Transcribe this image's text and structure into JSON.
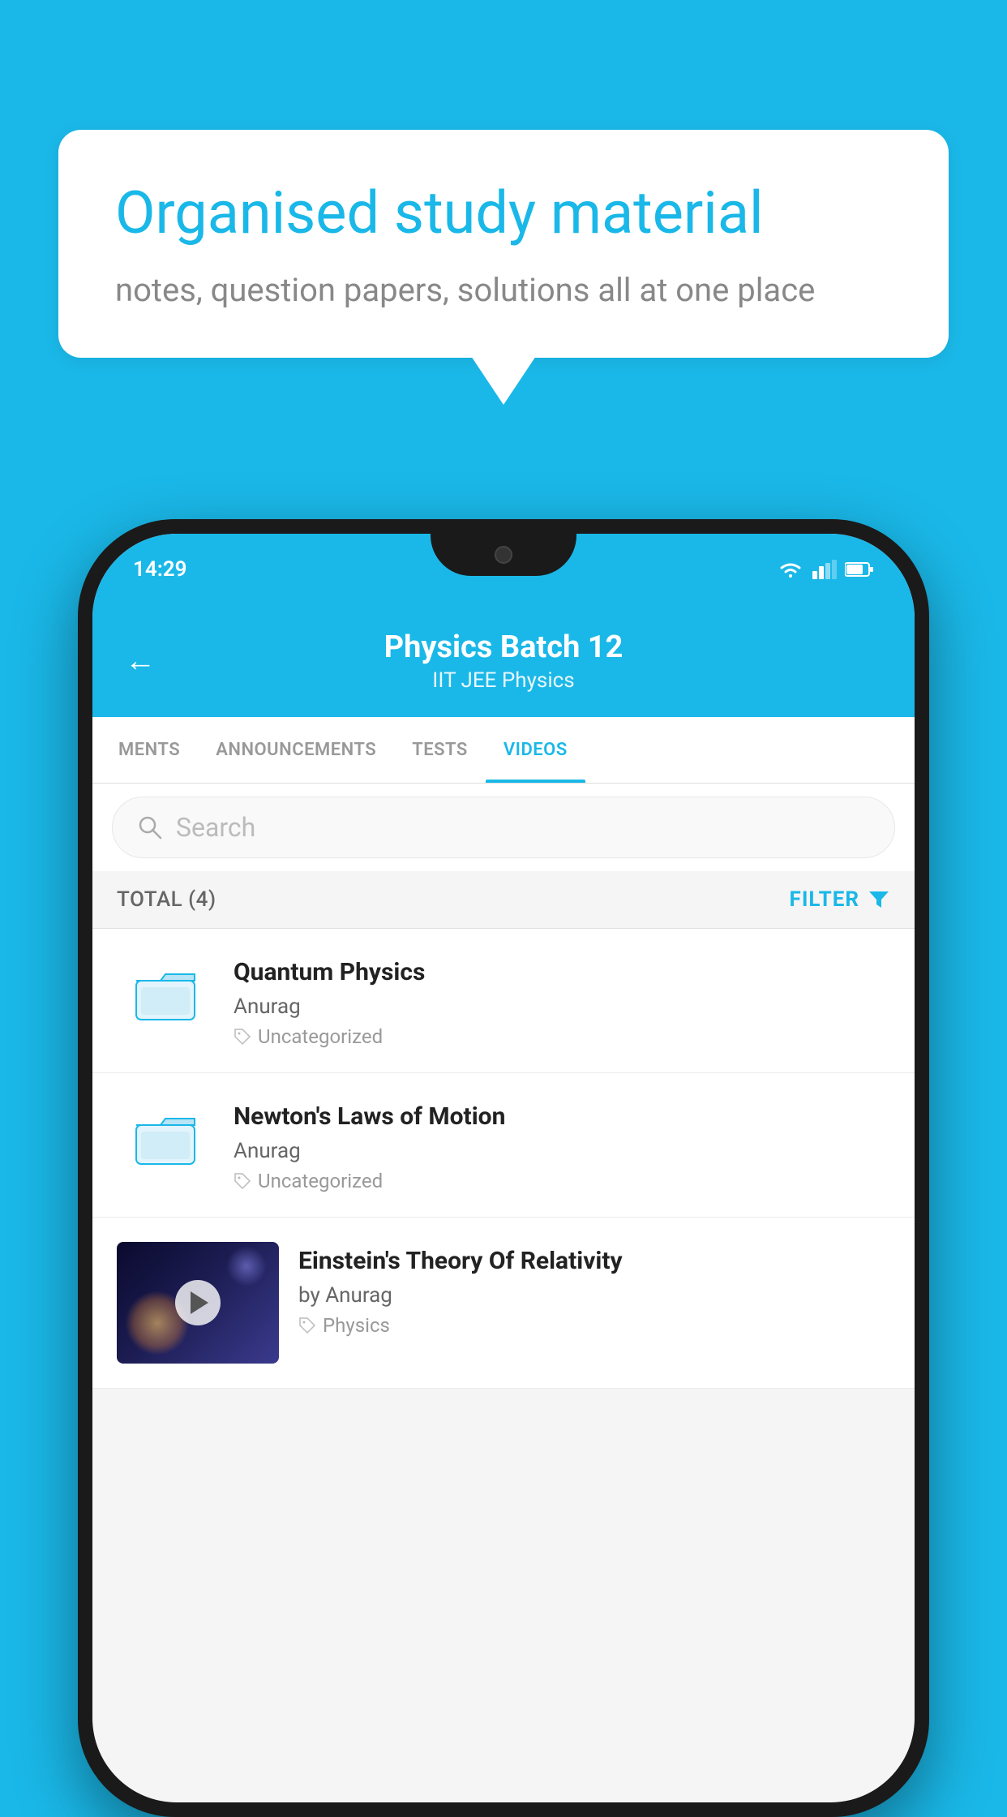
{
  "background": {
    "color": "#1ab8e8"
  },
  "speech_bubble": {
    "title": "Organised study material",
    "subtitle": "notes, question papers, solutions all at one place"
  },
  "phone": {
    "status_bar": {
      "time": "14:29"
    },
    "header": {
      "title": "Physics Batch 12",
      "subtitle": "IIT JEE   Physics",
      "back_label": "←"
    },
    "tabs": [
      {
        "label": "MENTS",
        "active": false
      },
      {
        "label": "ANNOUNCEMENTS",
        "active": false
      },
      {
        "label": "TESTS",
        "active": false
      },
      {
        "label": "VIDEOS",
        "active": true
      }
    ],
    "search": {
      "placeholder": "Search"
    },
    "filter_bar": {
      "total_label": "TOTAL (4)",
      "filter_label": "FILTER"
    },
    "videos": [
      {
        "id": 1,
        "title": "Quantum Physics",
        "author": "Anurag",
        "tag": "Uncategorized",
        "type": "folder"
      },
      {
        "id": 2,
        "title": "Newton's Laws of Motion",
        "author": "Anurag",
        "tag": "Uncategorized",
        "type": "folder"
      },
      {
        "id": 3,
        "title": "Einstein's Theory Of Relativity",
        "author": "by Anurag",
        "tag": "Physics",
        "type": "thumbnail"
      }
    ]
  }
}
